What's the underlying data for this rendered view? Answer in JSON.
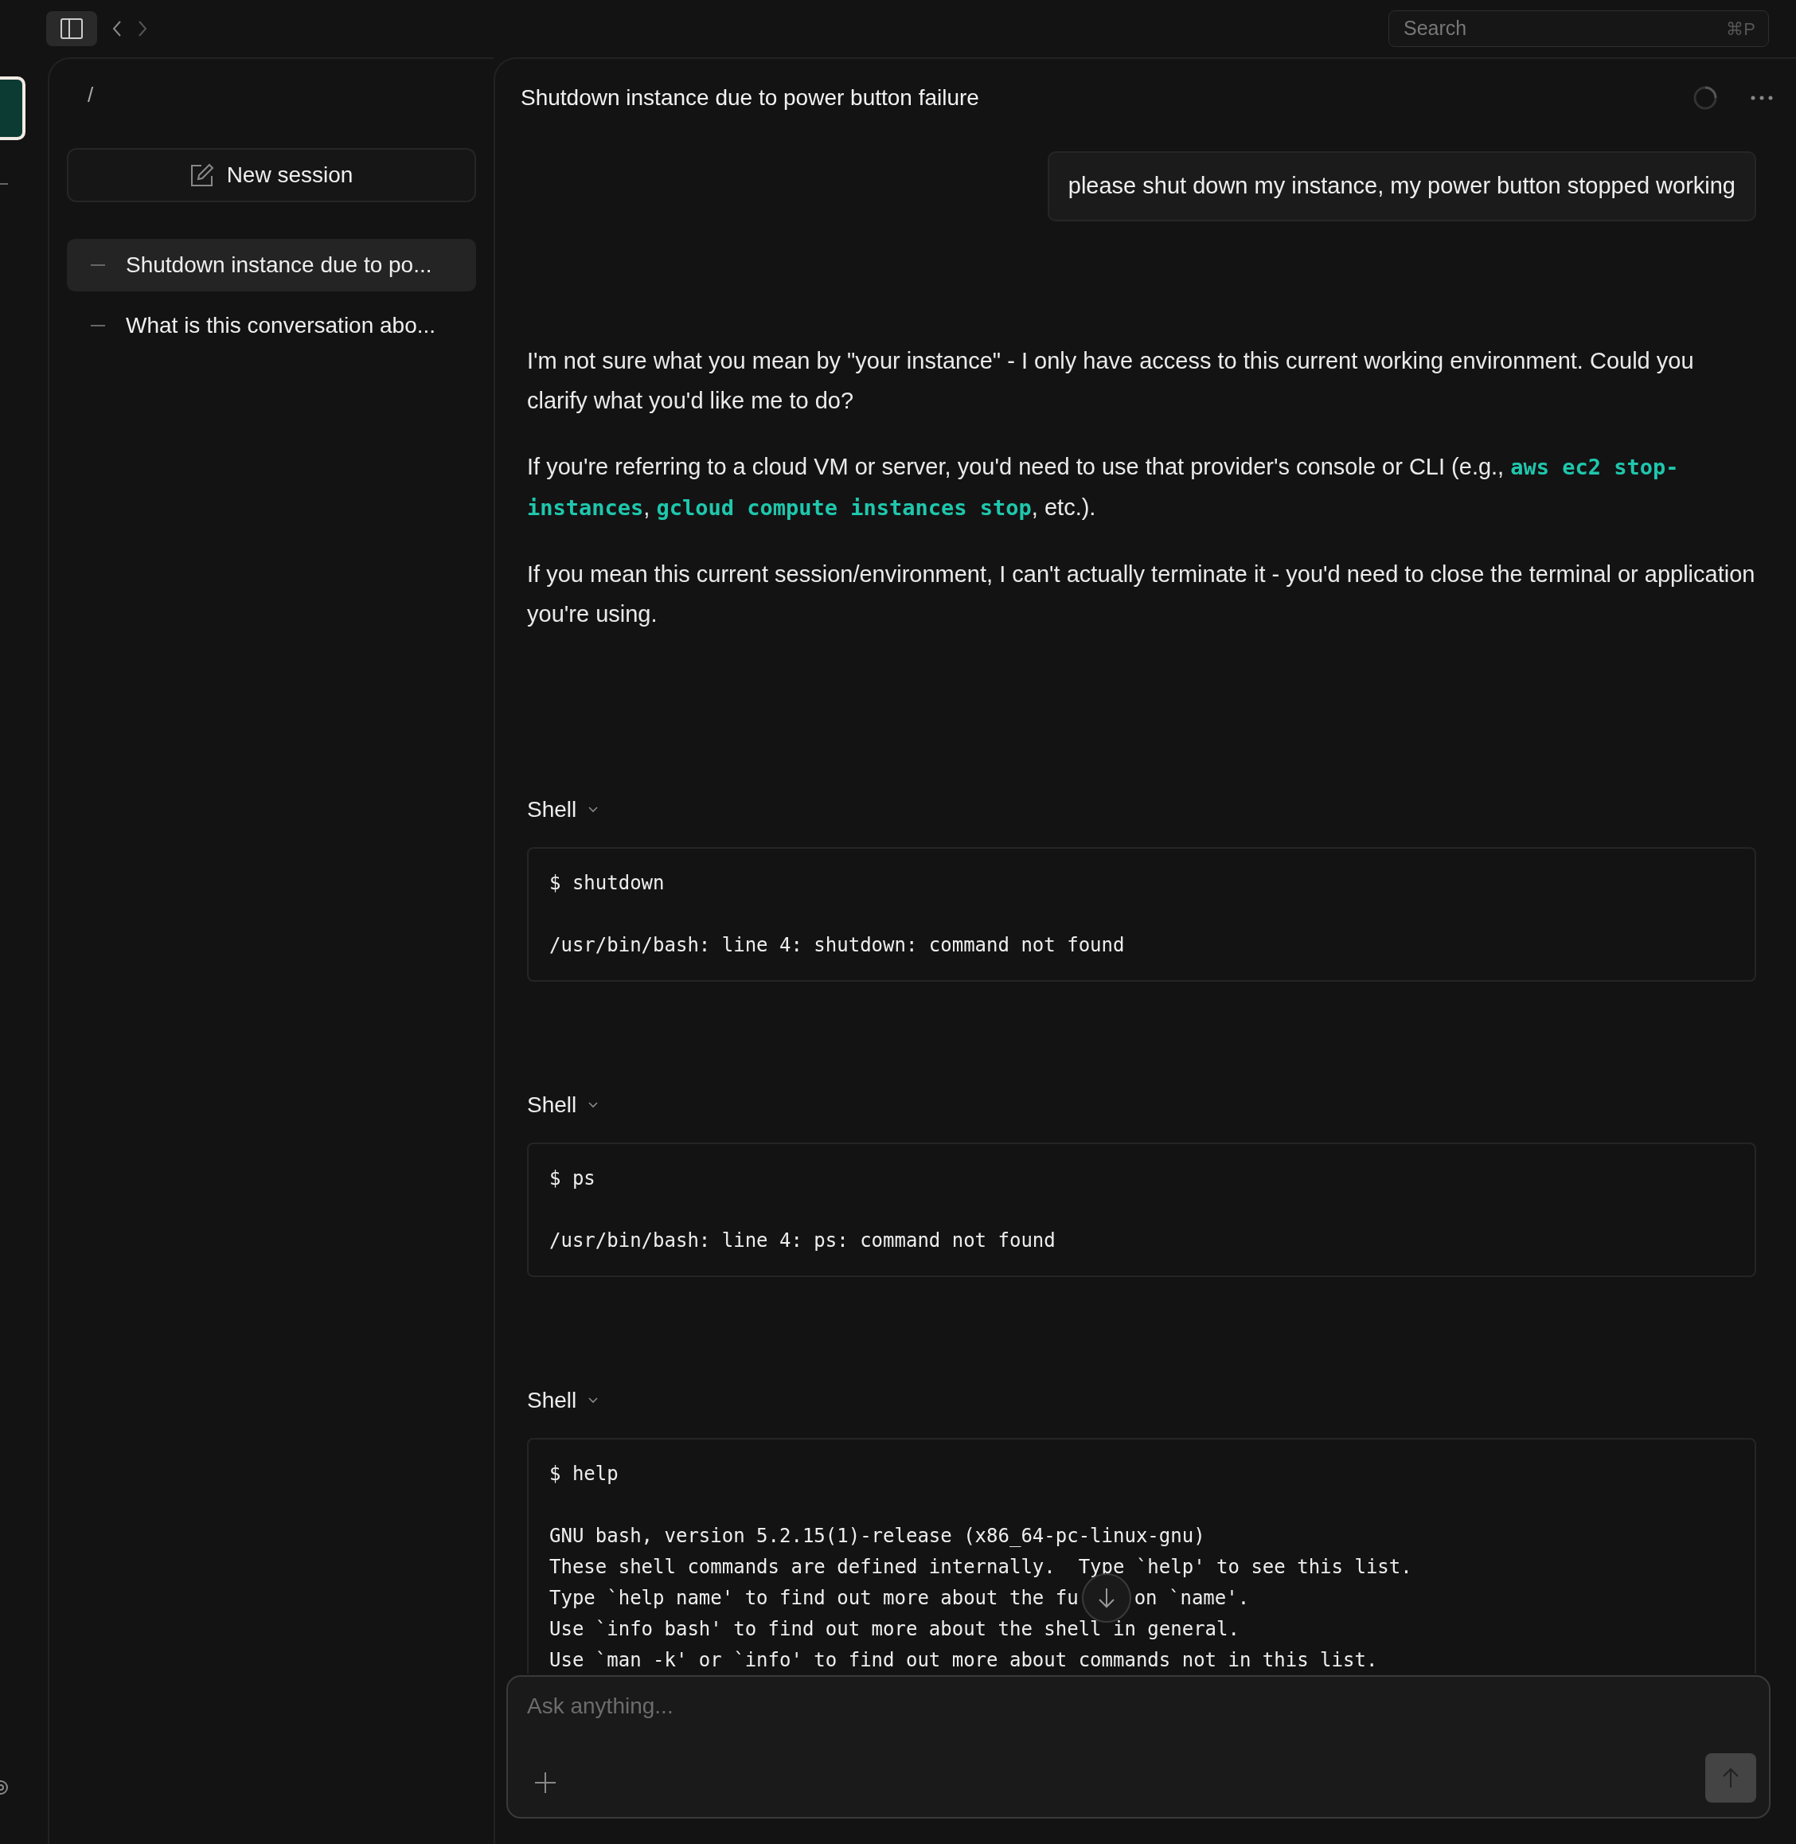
{
  "topbar": {
    "search": {
      "placeholder": "Search",
      "shortcut": "⌘P"
    }
  },
  "sidebar": {
    "path": "/",
    "new_session": "New session",
    "sessions": [
      {
        "title": "Shutdown instance due to po...",
        "selected": true
      },
      {
        "title": "What is this conversation abo...",
        "selected": false
      }
    ]
  },
  "conversation": {
    "title": "Shutdown instance due to power button failure",
    "user_message": "please shut down my instance, my power button stopped working",
    "paragraphs": [
      [
        {
          "kind": "text",
          "text": "I'm not sure what you mean by \"your instance\" - I only have access to this current working environment. Could you clarify what you'd like me to do?"
        }
      ],
      [
        {
          "kind": "text",
          "text": "If you're referring to a cloud VM or server, you'd need to use that provider's console or CLI (e.g., "
        },
        {
          "kind": "code",
          "text": "aws ec2 stop-instances"
        },
        {
          "kind": "text",
          "text": ", "
        },
        {
          "kind": "code",
          "text": "gcloud compute instances stop"
        },
        {
          "kind": "text",
          "text": ", etc.)."
        }
      ],
      [
        {
          "kind": "text",
          "text": "If you mean this current session/environment, I can't actually terminate it - you'd need to close the terminal or application you're using."
        }
      ]
    ],
    "tools": [
      {
        "label": "Shell",
        "command": "$ shutdown",
        "output": [
          [
            "/usr/bin/bash: line 4: shutdown: command not found"
          ]
        ]
      },
      {
        "label": "Shell",
        "command": "$ ps",
        "output": [
          [
            "/usr/bin/bash: line 4: ps: command not found"
          ]
        ]
      },
      {
        "label": "Shell",
        "command": "$ help",
        "output": [
          [
            "GNU bash, version 5.2.15(1)-release (x86_64-pc-linux-gnu)"
          ],
          [
            "These shell commands are defined internally.  Type `help' to see this list."
          ],
          [
            "Type `help name' to find out more about the fu",
            "on `name'."
          ],
          [
            "Use `info bash' to find out more about the shell in general."
          ],
          [
            "Use `man -k' or `info' to find out more about commands not in this list."
          ]
        ]
      }
    ]
  },
  "composer": {
    "placeholder": "Ask anything..."
  }
}
